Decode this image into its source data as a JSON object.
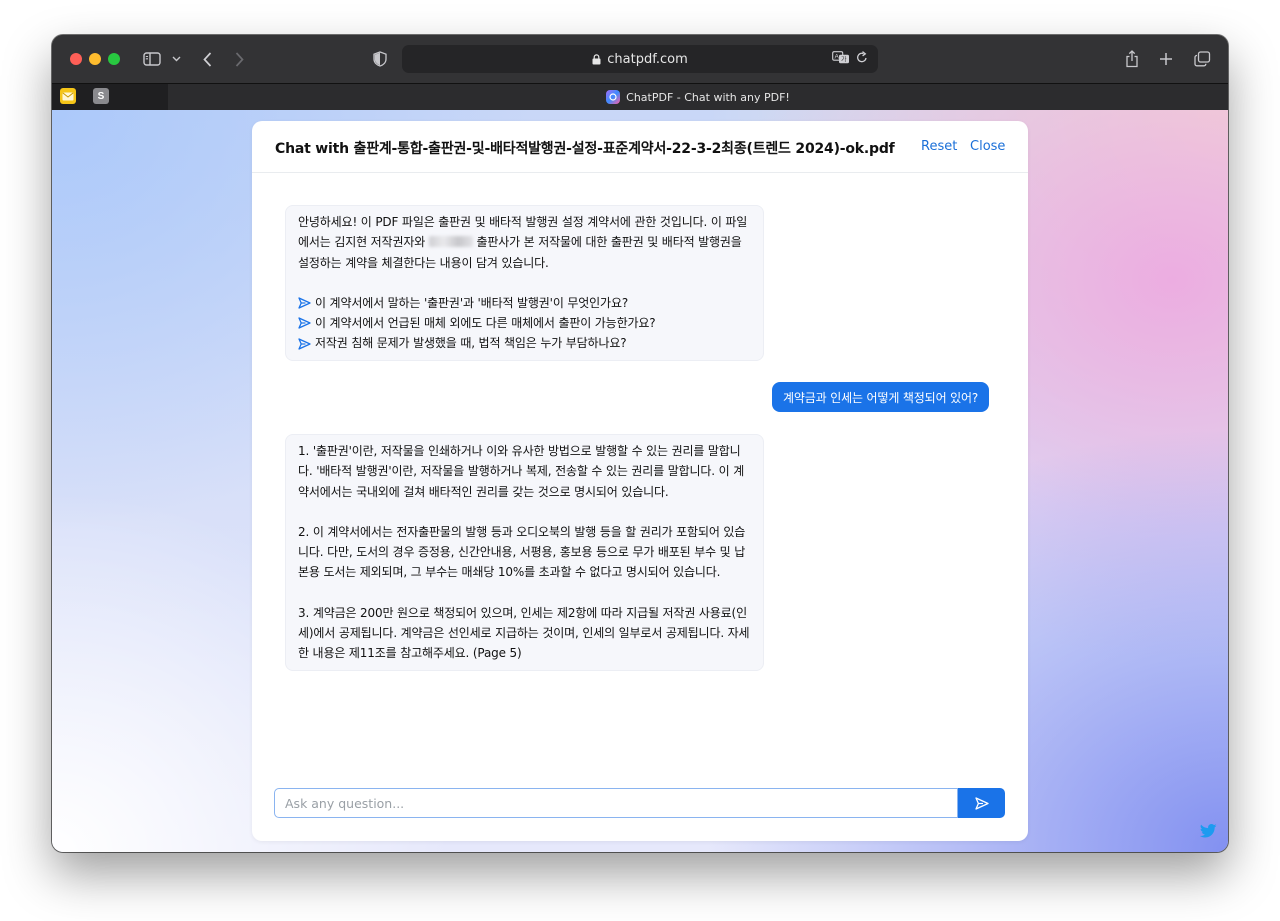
{
  "browser": {
    "url": "chatpdf.com",
    "tab_title": "ChatPDF - Chat with any PDF!",
    "pinned_tabs": [
      {
        "icon": "mail-icon",
        "color": "#f5c518"
      },
      {
        "icon": "s-app-icon",
        "letter": "S",
        "color": "#8a8a8e"
      }
    ]
  },
  "chat": {
    "title": "Chat with 출판계-통합-출판권-및-배타적발행권-설정-표준계약서-22-3-2최종(트렌드 2024)-ok.pdf",
    "reset_label": "Reset",
    "close_label": "Close",
    "intro": {
      "text_before": "안녕하세요! 이 PDF 파일은 출판권 및 배타적 발행권 설정 계약서에 관한 것입니다. 이 파일에서는 김지현 저작권자와 ",
      "text_after": " 출판사가 본 저작물에 대한 출판권 및 배타적 발행권을 설정하는 계약을 체결한다는 내용이 담겨 있습니다.",
      "suggestions": [
        "이 계약서에서 말하는 '출판권'과 '배타적 발행권'이 무엇인가요?",
        "이 계약서에서 언급된 매체 외에도 다른 매체에서 출판이 가능한가요?",
        "저작권 침해 문제가 발생했을 때, 법적 책임은 누가 부담하나요?"
      ]
    },
    "user_message": "계약금과 인세는 어떻게 책정되어 있어?",
    "answer": [
      "1. '출판권'이란, 저작물을 인쇄하거나 이와 유사한 방법으로 발행할 수 있는 권리를 말합니다. '배타적 발행권'이란, 저작물을 발행하거나 복제, 전송할 수 있는 권리를 말합니다. 이 계약서에서는 국내외에 걸쳐 배타적인 권리를 갖는 것으로 명시되어 있습니다.",
      "2. 이 계약서에서는 전자출판물의 발행 등과 오디오북의 발행 등을 할 권리가 포함되어 있습니다. 다만, 도서의 경우 증정용, 신간안내용, 서평용, 홍보용 등으로 무가 배포된 부수 및 납본용 도서는 제외되며, 그 부수는 매쇄당 10%를 초과할 수 없다고 명시되어 있습니다.",
      "3. 계약금은 200만 원으로 책정되어 있으며, 인세는 제2항에 따라 지급될 저작권 사용료(인세)에서 공제됩니다. 계약금은 선인세로 지급하는 것이며, 인세의 일부로서 공제됩니다. 자세한 내용은 제11조를 참고해주세요. (Page 5)"
    ],
    "input_placeholder": "Ask any question...",
    "input_value": ""
  },
  "colors": {
    "accent": "#1a73e8",
    "link": "#1a6fd8",
    "bot_bubble": "#f6f7fb",
    "twitter": "#1d9bf0"
  }
}
